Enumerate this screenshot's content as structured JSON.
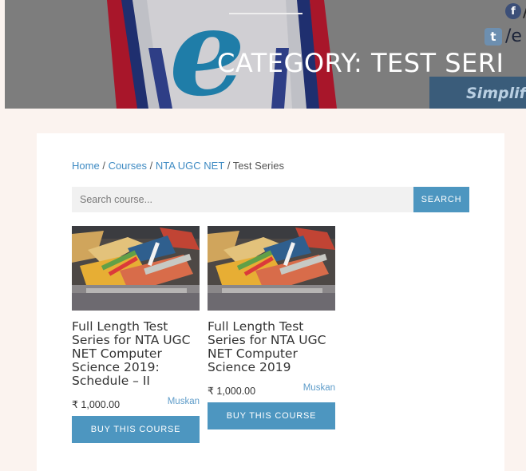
{
  "header": {
    "page_title": "CATEGORY: TEST SERI",
    "social": {
      "facebook_glyph": "f",
      "facebook_text": "/",
      "twitter_glyph": "t",
      "twitter_text": "/e"
    },
    "tagline": "Simplif"
  },
  "breadcrumb": {
    "items": [
      "Home",
      "Courses",
      "NTA UGC NET"
    ],
    "separator": "/",
    "current": "Test Series"
  },
  "search": {
    "placeholder": "Search course...",
    "button_label": "SEARCH"
  },
  "courses": [
    {
      "title": "Full Length Test Series for NTA UGC NET Computer Science 2019: Schedule – II",
      "price": "₹ 1,000.00",
      "author": "Muskan",
      "button_label": "BUY THIS COURSE"
    },
    {
      "title": "Full Length Test Series for NTA UGC NET Computer Science 2019",
      "price": "₹ 1,000.00",
      "author": "Muskan",
      "button_label": "BUY THIS COURSE"
    }
  ],
  "colors": {
    "accent": "#4d96c0",
    "link": "#3f8bc3",
    "hero_bg": "#7d7d7d"
  }
}
